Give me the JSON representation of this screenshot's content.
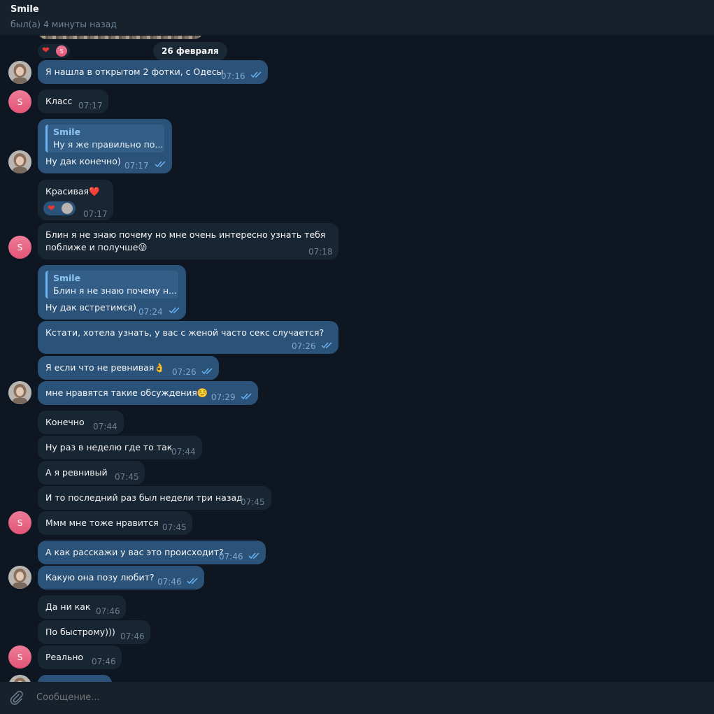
{
  "header": {
    "title": "Smile",
    "status": "был(а) 4 минуты назад"
  },
  "date_separator": "26 февраля",
  "contact_initial": "S",
  "reply_author": "Smile",
  "messages": [
    {
      "text": "Я нашла в открытом 2 фотки, с Одесы",
      "time": "07:16",
      "out": true
    },
    {
      "text": "Класс",
      "time": "07:17",
      "out": false
    },
    {
      "text": "Ну дак конечно)",
      "time": "07:17",
      "out": true,
      "reply": "Ну я же правильно по..."
    },
    {
      "text": "Красивая❤️",
      "time": "07:17",
      "out": false
    },
    {
      "text": "Блин я не знаю почему но мне очень интересно узнать тебя",
      "text2": "поближе и получше😜",
      "time": "07:18",
      "out": false
    },
    {
      "text": "Ну дак встретимся)",
      "time": "07:24",
      "out": true,
      "reply": "Блин я не знаю почему н..."
    },
    {
      "text": "Кстати, хотела узнать, у вас с женой часто секс случается?",
      "time": "07:26",
      "out": true
    },
    {
      "text": "Я если что не ревнивая👌",
      "time": "07:26",
      "out": true
    },
    {
      "text": "мне нравятся такие обсуждения☺️",
      "time": "07:29",
      "out": true
    },
    {
      "text": "Конечно",
      "time": "07:44",
      "out": false
    },
    {
      "text": "Ну раз в неделю где то так",
      "time": "07:44",
      "out": false
    },
    {
      "text": "А я ревнивый",
      "time": "07:45",
      "out": false
    },
    {
      "text": "И то последний раз был недели три назад",
      "time": "07:45",
      "out": false
    },
    {
      "text": "Ммм мне тоже нравится",
      "time": "07:45",
      "out": false
    },
    {
      "text": "А как расскажи у вас это происходит?",
      "time": "07:46",
      "out": true
    },
    {
      "text": "Какую она позу любит?",
      "time": "07:46",
      "out": true
    },
    {
      "text": "Да ни как",
      "time": "07:46",
      "out": false
    },
    {
      "text": "По быстрому)))",
      "time": "07:46",
      "out": false
    },
    {
      "text": "Реально",
      "time": "07:46",
      "out": false
    }
  ],
  "composer": {
    "placeholder": "Сообщение..."
  }
}
